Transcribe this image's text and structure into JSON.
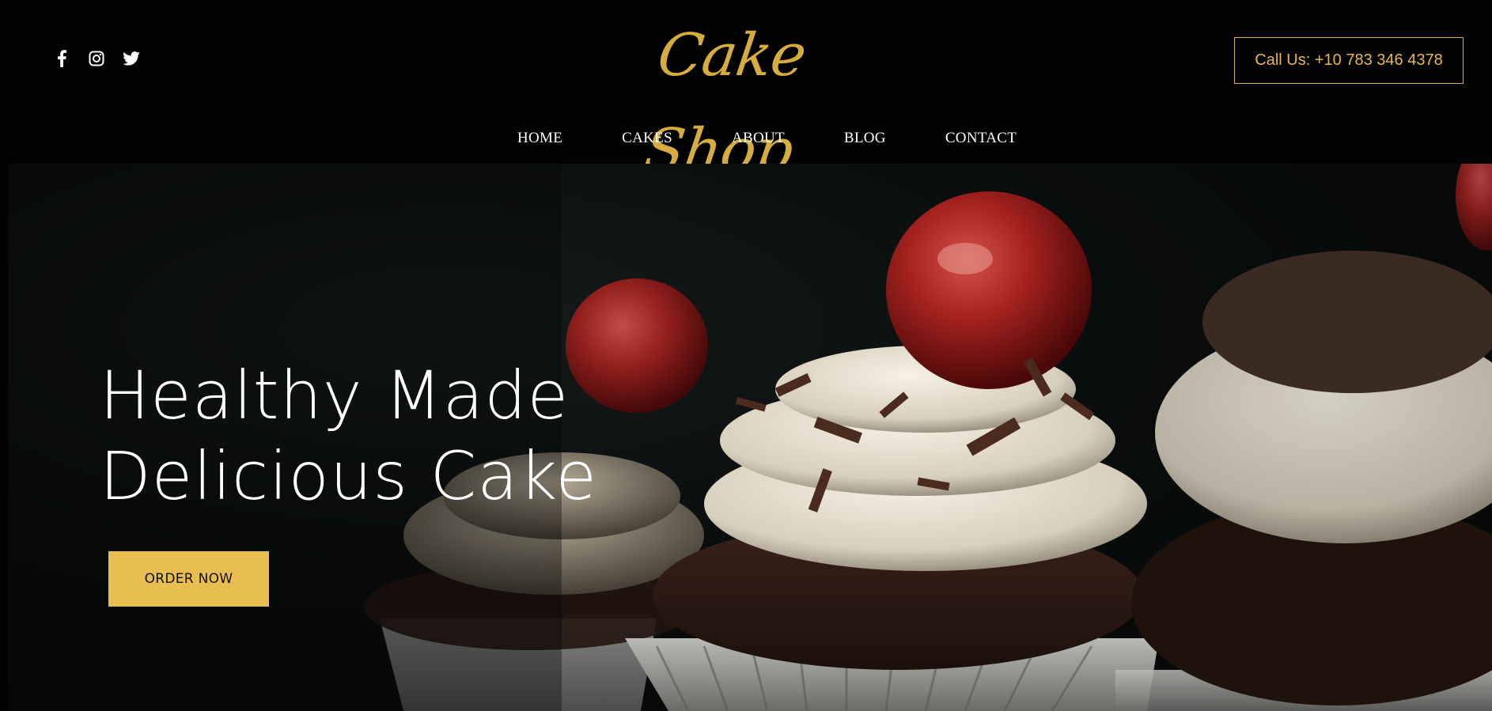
{
  "brand": {
    "logo_text": "Cake Shop",
    "accent_color": "#d7ac3e"
  },
  "social": [
    {
      "icon": "facebook-icon"
    },
    {
      "icon": "instagram-icon"
    },
    {
      "icon": "twitter-icon"
    }
  ],
  "header": {
    "call_label": "Call Us: +10 783 346 4378"
  },
  "nav": {
    "items": [
      {
        "label": "HOME"
      },
      {
        "label": "CAKES"
      },
      {
        "label": "ABOUT"
      },
      {
        "label": "BLOG"
      },
      {
        "label": "CONTACT"
      }
    ]
  },
  "hero": {
    "title_line1": "Healthy Made",
    "title_line2": "Delicious Cake",
    "cta_label": "ORDER NOW",
    "cta_color": "#e8be50",
    "image_subject": "chocolate cupcakes with whipped cream and cherries"
  }
}
